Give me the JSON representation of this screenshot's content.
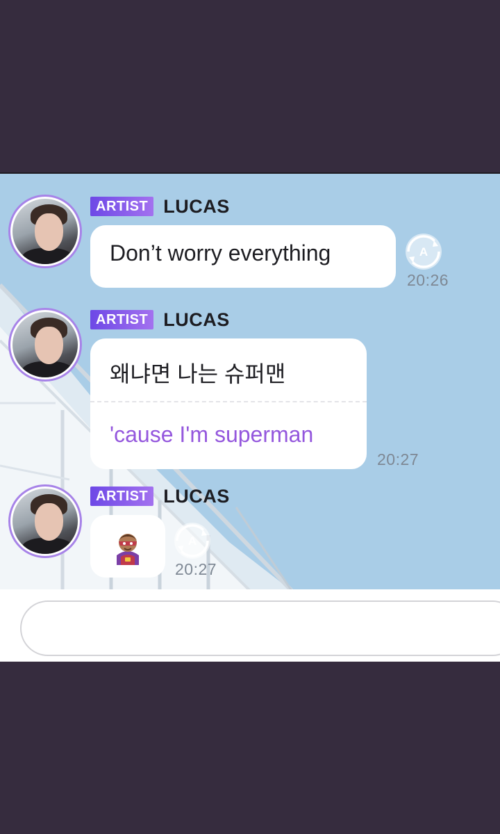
{
  "messages": [
    {
      "badge": "ARTIST",
      "sender": "LUCAS",
      "text": "Don’t worry everything",
      "time": "20:26"
    },
    {
      "badge": "ARTIST",
      "sender": "LUCAS",
      "text": "왜냐면 나는 슈퍼맨",
      "translation": "'cause I'm superman",
      "time": "20:27"
    },
    {
      "badge": "ARTIST",
      "sender": "LUCAS",
      "sticker": "superhero-emoji",
      "time": "20:27"
    }
  ],
  "icons": {
    "translate": "translate-icon"
  },
  "colors": {
    "page_background": "#362c3e",
    "chat_background": "#a9cde7",
    "artist_badge_start": "#6d48e6",
    "artist_badge_end": "#a371ef",
    "translation_text": "#9457dd",
    "avatar_ring": "#a783e8"
  },
  "input": {
    "value": "",
    "placeholder": ""
  }
}
